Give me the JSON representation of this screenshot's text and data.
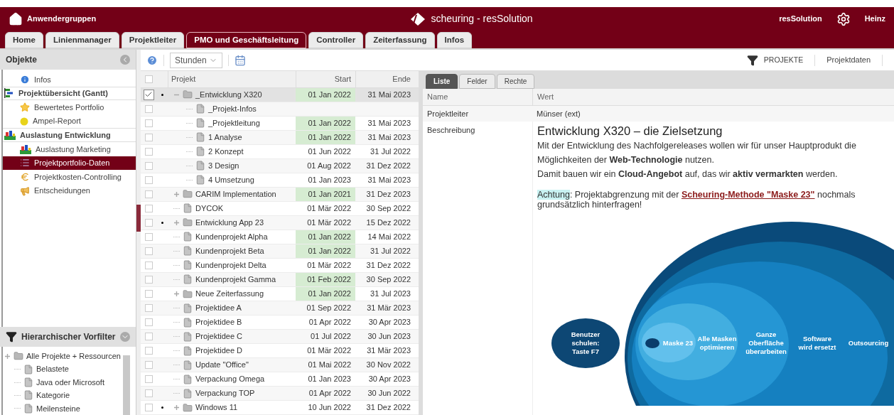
{
  "header": {
    "user_groups": "Anwendergruppen",
    "app_title": "scheuring - resSolution",
    "product": "resSolution",
    "user": "Heinz"
  },
  "tabs": [
    {
      "label": "Home",
      "selected": false
    },
    {
      "label": "Linienmanager",
      "selected": false
    },
    {
      "label": "Projektleiter",
      "selected": false
    },
    {
      "label": "PMO und Geschäftsleitung",
      "selected": true
    },
    {
      "label": "Controller",
      "selected": false
    },
    {
      "label": "Zeiterfassung",
      "selected": false
    },
    {
      "label": "Infos",
      "selected": false
    }
  ],
  "sidebar": {
    "title": "Objekte",
    "items": [
      {
        "label": "Infos",
        "kind": "item",
        "selected": false
      },
      {
        "label": "Projektübersicht (Gantt)",
        "kind": "group",
        "selected": false
      },
      {
        "label": "Bewertetes Portfolio",
        "kind": "item",
        "selected": false
      },
      {
        "label": "Ampel-Report",
        "kind": "item",
        "selected": false
      },
      {
        "label": "Auslastung Entwicklung",
        "kind": "group",
        "selected": false
      },
      {
        "label": "Auslastung Marketing",
        "kind": "item",
        "selected": false
      },
      {
        "label": "Projektportfolio-Daten",
        "kind": "item",
        "selected": true
      },
      {
        "label": "Projektkosten-Controlling",
        "kind": "item",
        "selected": false
      },
      {
        "label": "Entscheidungen",
        "kind": "item",
        "selected": false
      }
    ]
  },
  "prefilter": {
    "title": "Hierarchischer Vorfilter",
    "tree": [
      {
        "label": "Alle Projekte + Ressourcen",
        "kind": "folder",
        "children": [
          {
            "label": "Belastete",
            "kind": "file"
          },
          {
            "label": "Java oder Microsoft",
            "kind": "file"
          },
          {
            "label": "Kategorie",
            "kind": "file"
          },
          {
            "label": "Meilensteine",
            "kind": "file"
          }
        ]
      }
    ]
  },
  "toolbar": {
    "unit": "Stunden",
    "filter": "PROJEKTE",
    "link": "Projektdaten"
  },
  "grid": {
    "columns": [
      "Projekt",
      "Start",
      "Ende"
    ],
    "select_all_checked": false,
    "rows": [
      {
        "name": "_Entwicklung X320",
        "kind": "folder",
        "expanded": true,
        "checked": true,
        "bullet": true,
        "selected": true,
        "start": "01 Jan 2022",
        "end": "31 Mai 2023",
        "start_highlighted": true,
        "children": [
          {
            "name": "_Projekt-Infos",
            "kind": "file",
            "checked": false,
            "bullet": false,
            "selected": false
          },
          {
            "name": "_Projektleitung",
            "kind": "file",
            "checked": false,
            "bullet": false,
            "selected": false,
            "start": "01 Jan 2022",
            "end": "31 Mai 2023",
            "start_highlighted": true
          },
          {
            "name": "1 Analyse",
            "kind": "file",
            "checked": false,
            "bullet": false,
            "selected": false,
            "start": "01 Jan 2022",
            "end": "31 Mai 2023",
            "start_highlighted": true
          },
          {
            "name": "2 Konzept",
            "kind": "file",
            "checked": false,
            "bullet": false,
            "selected": false,
            "start": "01 Jun 2022",
            "end": "31 Jul 2022",
            "start_highlighted": false
          },
          {
            "name": "3 Design",
            "kind": "file",
            "checked": false,
            "bullet": false,
            "selected": false,
            "start": "01 Aug 2022",
            "end": "31 Dez 2022",
            "start_highlighted": false
          },
          {
            "name": "4 Umsetzung",
            "kind": "file",
            "checked": false,
            "bullet": false,
            "selected": false,
            "start": "01 Jan 2023",
            "end": "31 Mai 2023",
            "start_highlighted": false
          }
        ]
      },
      {
        "name": "CARIM Implementation",
        "kind": "folder",
        "expanded": false,
        "checked": false,
        "bullet": false,
        "selected": false,
        "start": "01 Jan 2021",
        "end": "31 Dez 2023",
        "start_highlighted": true
      },
      {
        "name": "DYCOK",
        "kind": "file",
        "checked": false,
        "bullet": false,
        "selected": false,
        "start": "01 Mär 2022",
        "end": "30 Sep 2022",
        "start_highlighted": false
      },
      {
        "name": "Entwicklung App 23",
        "kind": "folder",
        "expanded": false,
        "checked": false,
        "bullet": true,
        "selected": false,
        "start": "01 Mär 2022",
        "end": "15 Dez 2022",
        "start_highlighted": false
      },
      {
        "name": "Kundenprojekt Alpha",
        "kind": "file",
        "checked": false,
        "bullet": false,
        "selected": false,
        "start": "01 Jan 2022",
        "end": "14 Mai 2022",
        "start_highlighted": true
      },
      {
        "name": "Kundenprojekt Beta",
        "kind": "file",
        "checked": false,
        "bullet": false,
        "selected": false,
        "start": "01 Jan 2022",
        "end": "31 Jul 2022",
        "start_highlighted": true
      },
      {
        "name": "Kundenprojekt Delta",
        "kind": "file",
        "checked": false,
        "bullet": false,
        "selected": false,
        "start": "01 Mär 2022",
        "end": "31 Dez 2022",
        "start_highlighted": false
      },
      {
        "name": "Kundenprojekt Gamma",
        "kind": "file",
        "checked": false,
        "bullet": false,
        "selected": false,
        "start": "01 Feb 2022",
        "end": "30 Sep 2022",
        "start_highlighted": true
      },
      {
        "name": "Neue Zeiterfassung",
        "kind": "folder",
        "expanded": false,
        "checked": false,
        "bullet": false,
        "selected": false,
        "start": "01 Jan 2022",
        "end": "31 Jul 2023",
        "start_highlighted": true
      },
      {
        "name": "Projektidee A",
        "kind": "file",
        "checked": false,
        "bullet": false,
        "selected": false,
        "start": "01 Sep 2022",
        "end": "31 Mär 2023",
        "start_highlighted": false
      },
      {
        "name": "Projektidee B",
        "kind": "file",
        "checked": false,
        "bullet": false,
        "selected": false,
        "start": "01 Apr 2022",
        "end": "30 Apr 2023",
        "start_highlighted": false
      },
      {
        "name": "Projektidee C",
        "kind": "file",
        "checked": false,
        "bullet": false,
        "selected": false,
        "start": "01 Jul 2022",
        "end": "30 Jun 2023",
        "start_highlighted": false
      },
      {
        "name": "Projektidee D",
        "kind": "file",
        "checked": false,
        "bullet": false,
        "selected": false,
        "start": "01 Mär 2022",
        "end": "31 Mär 2023",
        "start_highlighted": false
      },
      {
        "name": "Update \"Office\"",
        "kind": "file",
        "checked": false,
        "bullet": false,
        "selected": false,
        "start": "01 Mai 2022",
        "end": "30 Nov 2022",
        "start_highlighted": false
      },
      {
        "name": "Verpackung Omega",
        "kind": "file",
        "checked": false,
        "bullet": false,
        "selected": false,
        "start": "01 Jan 2023",
        "end": "30 Apr 2023",
        "start_highlighted": false
      },
      {
        "name": "Verpackung TOP",
        "kind": "file",
        "checked": false,
        "bullet": false,
        "selected": false,
        "start": "01 Apr 2022",
        "end": "30 Jun 2022",
        "start_highlighted": false
      },
      {
        "name": "Windows 11",
        "kind": "folder",
        "expanded": false,
        "checked": false,
        "bullet": true,
        "selected": false,
        "start": "10 Jun 2022",
        "end": "31 Dez 2022",
        "start_highlighted": false
      }
    ]
  },
  "detail": {
    "tabs": [
      {
        "label": "Liste",
        "selected": true
      },
      {
        "label": "Felder",
        "selected": false
      },
      {
        "label": "Rechte",
        "selected": false
      }
    ],
    "columns": [
      "Name",
      "Wert"
    ],
    "fields": [
      {
        "name": "Projektleiter",
        "value": "Münser (ext)"
      }
    ],
    "description": {
      "name": "Beschreibung",
      "heading": "Entwicklung X320 – die Zielsetzung",
      "paragraphs": [
        "Mit der Entwicklung des Nachfolgereleases wollen wir für unser Hauptprodukt die Möglichkeiten der **Web-Technologie** nutzen.",
        "Damit bauen wir ein **Cloud-Angebot** auf, das wir **aktiv vermarkten** werden."
      ],
      "note": {
        "highlight": "Achtung",
        "text": ": Projektabgrenzung mit der ",
        "link": "Scheuring-Methode \"Maske 23\"",
        "after": " nochmals grundsätzlich hinterfragen!"
      },
      "diagram": {
        "labels": [
          [
            "Benutzer",
            "schulen:",
            "Taste F7"
          ],
          [
            "Maske 23"
          ],
          [
            "Alle Masken",
            "optimieren"
          ],
          [
            "Ganze",
            "Oberfläche",
            "überarbeiten"
          ],
          [
            "Software",
            "wird ersetzt"
          ],
          [
            "Outsourcing"
          ]
        ]
      }
    }
  }
}
